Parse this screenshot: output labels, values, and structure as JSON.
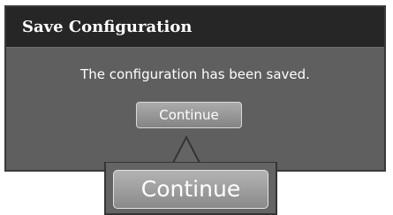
{
  "dialog": {
    "title": "Save Configuration",
    "message": "The configuration has been saved.",
    "continue_label": "Continue"
  },
  "callout": {
    "continue_label": "Continue"
  },
  "colors": {
    "header_bg": "#262626",
    "body_bg": "#5f5f5f",
    "button_gradient_top": "#ababab",
    "button_gradient_bottom": "#848484",
    "text": "#ffffff"
  }
}
